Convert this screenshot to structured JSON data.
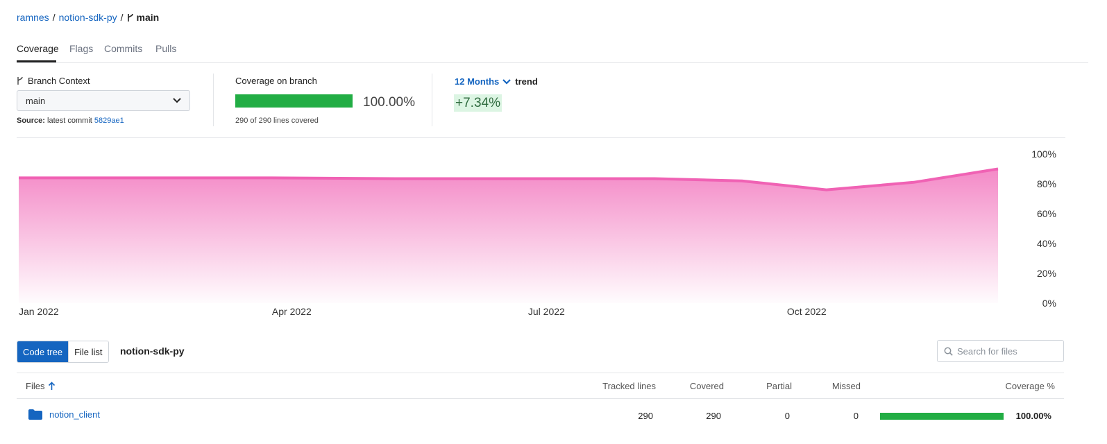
{
  "breadcrumb": {
    "owner": "ramnes",
    "repo": "notion-sdk-py",
    "sep": "/",
    "branch": "main"
  },
  "tabs": [
    {
      "label": "Coverage",
      "active": true
    },
    {
      "label": "Flags"
    },
    {
      "label": "Commits"
    },
    {
      "label": "Pulls"
    }
  ],
  "branch_context": {
    "title": "Branch Context",
    "selected": "main",
    "source_label": "Source:",
    "source_text": "latest commit",
    "commit": "5829ae1"
  },
  "coverage_on_branch": {
    "title": "Coverage on branch",
    "percent_text": "100.00%",
    "fill_fraction": 1.0,
    "lines_text": "290 of 290 lines covered"
  },
  "trend": {
    "period": "12 Months",
    "word": "trend",
    "value": "+7.34%"
  },
  "chart_data": {
    "type": "area",
    "x": [
      "2022-01-01",
      "2022-02-15",
      "2022-04-01",
      "2022-05-15",
      "2022-07-01",
      "2022-08-15",
      "2022-09-15",
      "2022-10-15",
      "2022-11-15",
      "2022-12-15"
    ],
    "values": [
      84,
      84,
      84,
      83.5,
      83.5,
      83.5,
      82,
      76,
      81,
      90
    ],
    "xtick_labels": [
      "Jan 2022",
      "Apr 2022",
      "Jul 2022",
      "Oct 2022"
    ],
    "xtick_dates": [
      "2022-01-01",
      "2022-04-01",
      "2022-07-01",
      "2022-10-01"
    ],
    "ytick_labels": [
      "100%",
      "80%",
      "60%",
      "40%",
      "20%",
      "0%"
    ],
    "ylim": [
      0,
      100
    ],
    "x_domain": [
      "2022-01-01",
      "2022-12-15"
    ],
    "color": "#f062b4",
    "grid": false
  },
  "tree": {
    "toggle_on": "Code tree",
    "toggle_off": "File list",
    "repo": "notion-sdk-py",
    "search_placeholder": "Search for files"
  },
  "table": {
    "headers": {
      "files": "Files",
      "tracked": "Tracked lines",
      "covered": "Covered",
      "partial": "Partial",
      "missed": "Missed",
      "coverage": "Coverage %"
    },
    "rows": [
      {
        "name": "notion_client",
        "tracked": "290",
        "covered": "290",
        "partial": "0",
        "missed": "0",
        "coverage_text": "100.00%",
        "fill_fraction": 1.0
      }
    ]
  },
  "colors": {
    "accent": "#1565c0",
    "green": "#22ad44",
    "pink": "#f062b4"
  }
}
